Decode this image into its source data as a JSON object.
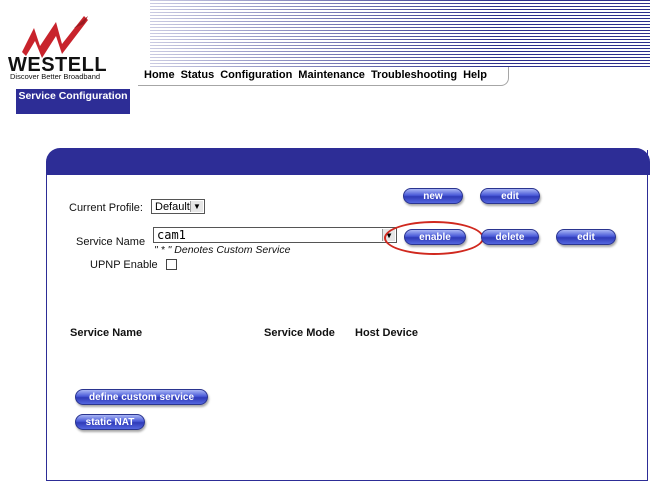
{
  "brand": {
    "name": "WESTELL",
    "tagline": "Discover Better Broadband"
  },
  "nav": [
    "Home",
    "Status",
    "Configuration",
    "Maintenance",
    "Troubleshooting",
    "Help"
  ],
  "section_tab": "Service Configuration",
  "form": {
    "current_profile_label": "Current Profile:",
    "current_profile_value": "Default",
    "service_name_label": "Service Name",
    "service_name_value": "cam1",
    "custom_service_note": "\" * \" Denotes Custom Service",
    "upnp_label": "UPNP Enable",
    "upnp_checked": false
  },
  "buttons": {
    "profile_new": "new",
    "profile_edit": "edit",
    "service_enable": "enable",
    "service_delete": "delete",
    "service_edit": "edit",
    "define_custom_service": "define custom service",
    "static_nat": "static NAT"
  },
  "table_headers": [
    "Service Name",
    "Service Mode",
    "Host Device"
  ],
  "colors": {
    "accent": "#2d2d96",
    "highlight": "#d0281e",
    "logo_red": "#c8232c"
  }
}
